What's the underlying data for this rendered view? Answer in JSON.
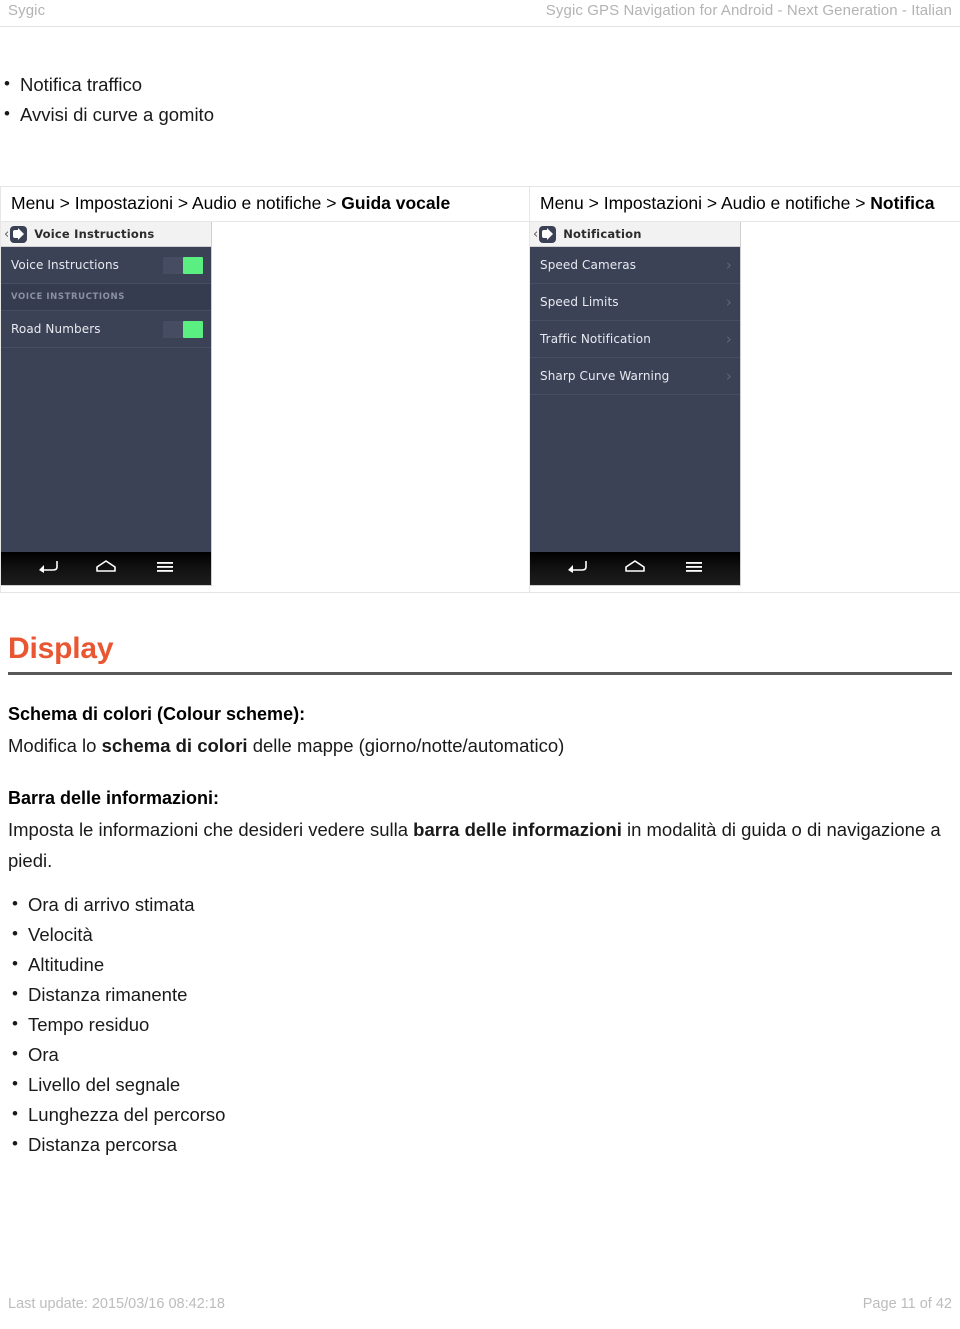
{
  "header": {
    "left": "Sygic",
    "right": "Sygic GPS Navigation for Android - Next Generation - Italian"
  },
  "top_list": [
    "Notifica traffico",
    "Avvisi di curve a gomito"
  ],
  "captions": {
    "left_prefix": "Menu > Impostazioni > Audio e notifiche > ",
    "left_bold": "Guida vocale",
    "right_prefix": "Menu > Impostazioni > Audio e notifiche > ",
    "right_bold": "Notifica"
  },
  "screenshot_left": {
    "title": "Voice Instructions",
    "rows": [
      {
        "label": "Voice Instructions",
        "control": "toggle-on"
      },
      {
        "label": "VOICE INSTRUCTIONS",
        "control": "section"
      },
      {
        "label": "Road Numbers",
        "control": "toggle-on"
      }
    ],
    "nav": [
      "back-icon",
      "home-icon",
      "recents-icon"
    ]
  },
  "screenshot_right": {
    "title": "Notification",
    "rows": [
      {
        "label": "Speed Cameras",
        "control": "chevron"
      },
      {
        "label": "Speed Limits",
        "control": "chevron"
      },
      {
        "label": "Traffic Notification",
        "control": "chevron"
      },
      {
        "label": "Sharp Curve Warning",
        "control": "chevron"
      }
    ],
    "nav": [
      "back-icon",
      "home-icon",
      "recents-icon"
    ]
  },
  "display_section": {
    "title": "Display",
    "colour_scheme": {
      "heading": "Schema di colori (Colour scheme):",
      "body_1": "Modifica lo ",
      "body_bold": "schema di colori",
      "body_2": " delle mappe (giorno/notte/automatico)"
    },
    "info_bar": {
      "heading": "Barra delle informazioni:",
      "body_1": "Imposta le informazioni che desideri vedere sulla ",
      "body_bold": "barra delle informazioni",
      "body_2": " in modalità di guida o di navigazione a piedi."
    },
    "items": [
      "Ora di arrivo stimata",
      "Velocità",
      "Altitudine",
      "Distanza rimanente",
      "Tempo residuo",
      "Ora",
      "Livello del segnale",
      "Lunghezza del percorso",
      "Distanza percorsa"
    ]
  },
  "footer": {
    "left": "Last update: 2015/03/16 08:42:18",
    "right": "Page 11 of 42"
  },
  "colors": {
    "accent": "#e85632",
    "toggle_on": "#5bef82",
    "phone_bg": "#3c4256"
  }
}
